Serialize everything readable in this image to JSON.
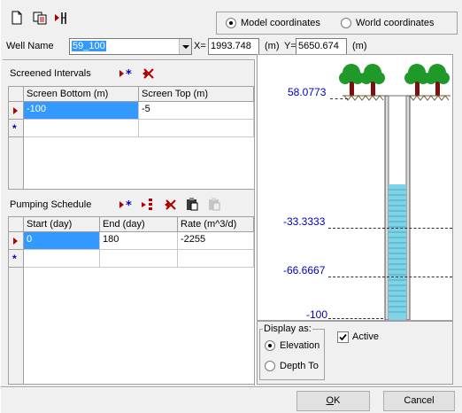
{
  "toolbar": {
    "icons": [
      "new-document-icon",
      "copy-well-icon",
      "split-icon"
    ]
  },
  "coordinates": {
    "model_label": "Model coordinates",
    "world_label": "World coordinates",
    "selected": "model"
  },
  "well": {
    "name_label": "Well Name",
    "name_value": "59_100",
    "x_label": "X=",
    "x_value": "1993.748",
    "x_unit": "(m)",
    "y_label": "Y=",
    "y_value": "5650.674",
    "y_unit": "(m)"
  },
  "screened": {
    "title": "Screened Intervals",
    "columns": [
      "Screen Bottom (m)",
      "Screen Top (m)"
    ],
    "rows": [
      [
        "-100",
        "-5"
      ]
    ],
    "new_row_marker": "*"
  },
  "pumping": {
    "title": "Pumping Schedule",
    "columns": [
      "Start (day)",
      "End (day)",
      "Rate (m^3/d)"
    ],
    "rows": [
      [
        "0",
        "180",
        "-2255"
      ]
    ],
    "new_row_marker": "*"
  },
  "diagram": {
    "elevations": [
      "58.0773",
      "-33.3333",
      "-66.6667",
      "-100"
    ]
  },
  "display": {
    "group_label": "Display as:",
    "elevation_label": "Elevation",
    "depth_label": "Depth To",
    "selected": "elevation",
    "active_label": "Active",
    "active_checked": true
  },
  "buttons": {
    "ok_prefix": "O",
    "ok_rest": "K",
    "cancel_label": "Cancel"
  },
  "colors": {
    "selection": "#3399ff",
    "elevation_text": "#0000c0",
    "tree_green": "#1f9a2a",
    "trunk_brown": "#7a1010",
    "water": "#7fd3e6"
  }
}
